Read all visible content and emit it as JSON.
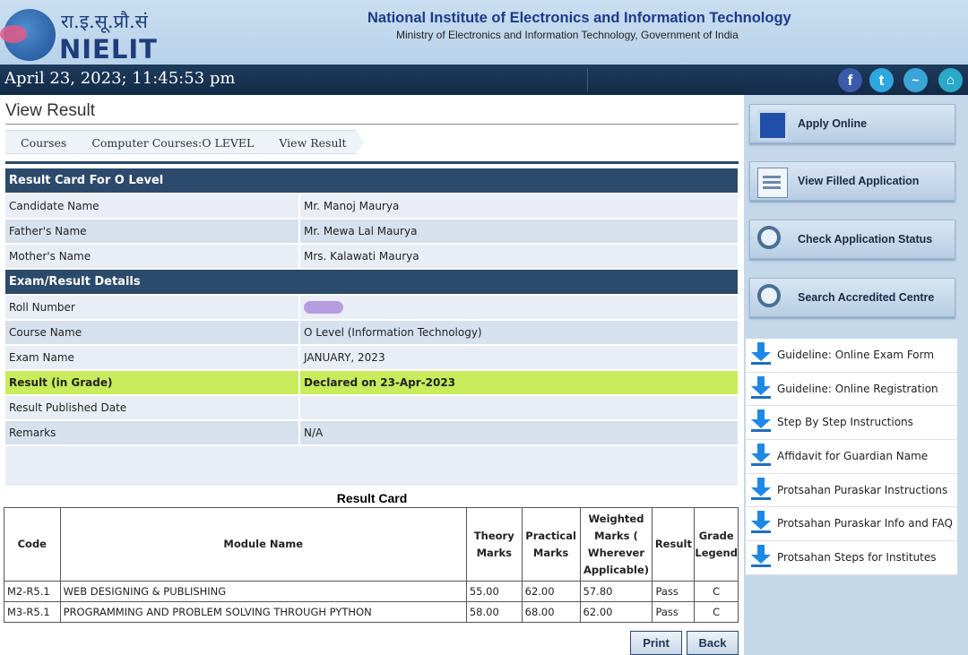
{
  "header": {
    "logo_hindi": "रा.इ.सू.प्रौ.सं",
    "logo_name": "NIELIT",
    "title": "National Institute of Electronics and Information Technology",
    "subtitle": "Ministry of Electronics and Information Technology, Government of India"
  },
  "datebar": {
    "datetime": "April 23, 2023; 11:45:53 pm",
    "social": [
      "facebook-icon",
      "twitter-icon",
      "stats-icon",
      "home-icon"
    ]
  },
  "page": {
    "title": "View Result",
    "breadcrumbs": [
      "Courses",
      "Computer Courses:O LEVEL",
      "View Result"
    ]
  },
  "result_card_header": "Result Card For O Level",
  "candidate": [
    {
      "label": "Candidate Name",
      "value": "Mr. Manoj Maurya"
    },
    {
      "label": "Father's Name",
      "value": "Mr. Mewa Lal Maurya"
    },
    {
      "label": "Mother's Name",
      "value": "Mrs. Kalawati Maurya"
    }
  ],
  "exam_header": "Exam/Result Details",
  "exam": [
    {
      "label": "Roll Number",
      "value": ""
    },
    {
      "label": "Course Name",
      "value": "O Level (Information Technology)"
    },
    {
      "label": "Exam Name",
      "value": "JANUARY, 2023"
    },
    {
      "label": "Result (in Grade)",
      "value": "Declared on 23-Apr-2023"
    },
    {
      "label": "Result Published Date",
      "value": ""
    },
    {
      "label": "Remarks",
      "value": "N/A"
    }
  ],
  "result_card": {
    "title": "Result Card",
    "columns": [
      "Code",
      "Module Name",
      "Theory Marks",
      "Practical Marks",
      "Weighted Marks ( Wherever Applicable)",
      "Result",
      "Grade Legend"
    ],
    "rows": [
      [
        "M2-R5.1",
        "WEB DESIGNING & PUBLISHING",
        "55.00",
        "62.00",
        "57.80",
        "Pass",
        "C"
      ],
      [
        "M3-R5.1",
        "PROGRAMMING AND PROBLEM SOLVING THROUGH PYTHON",
        "58.00",
        "68.00",
        "62.00",
        "Pass",
        "C"
      ]
    ]
  },
  "buttons": {
    "print": "Print",
    "back": "Back"
  },
  "sidebar": {
    "buttons": [
      {
        "label": "Apply Online",
        "icon": "monitor-icon"
      },
      {
        "label": "View Filled Application",
        "icon": "document-icon"
      },
      {
        "label": "Check Application Status",
        "icon": "magnifier-icon"
      },
      {
        "label": "Search Accredited Centre",
        "icon": "magnifier-icon"
      }
    ],
    "links": [
      "Guideline: Online Exam Form",
      "Guideline: Online Registration",
      "Step By Step Instructions",
      "Affidavit for Guardian Name",
      "Protsahan Puraskar Instructions",
      "Protsahan Puraskar Info and FAQ",
      "Protsahan Steps for Institutes"
    ]
  }
}
